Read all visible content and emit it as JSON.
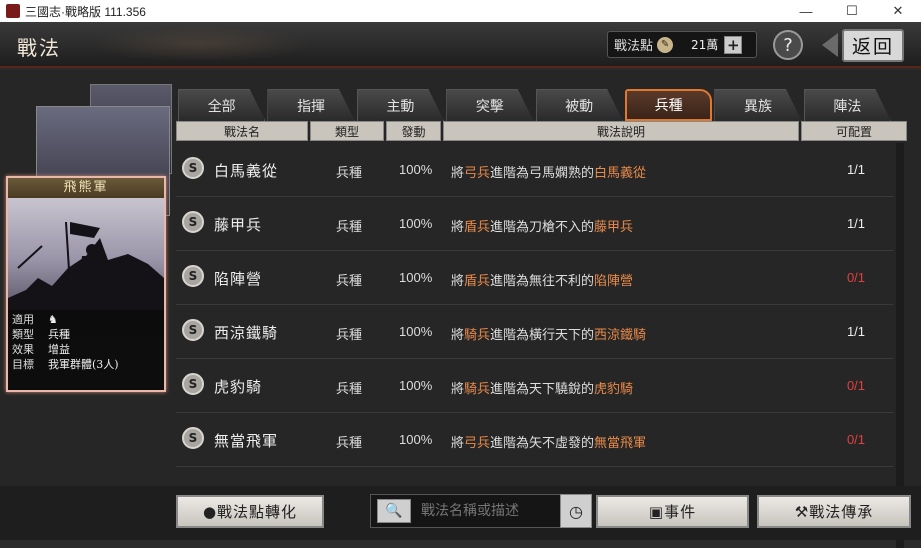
{
  "window": {
    "title": "三國志·戰略版 111.356",
    "minimize": "—",
    "maximize": "☐",
    "close": "✕"
  },
  "header": {
    "title": "戰法",
    "points_label": "戰法點",
    "points_value": "21",
    "points_unit": "萬",
    "plus": "+",
    "help": "?",
    "back": "返回"
  },
  "card": {
    "name": "飛熊軍",
    "rows": [
      {
        "key": "適用",
        "value": ""
      },
      {
        "key": "類型",
        "value": "兵種"
      },
      {
        "key": "效果",
        "value": "增益"
      },
      {
        "key": "目標",
        "value": "我軍群體(3人)"
      }
    ]
  },
  "tabs": [
    "全部",
    "指揮",
    "主動",
    "突擊",
    "被動",
    "兵種",
    "異族",
    "陣法"
  ],
  "active_tab": "兵種",
  "columns": [
    "戰法名",
    "類型",
    "發動",
    "戰法說明",
    "可配置"
  ],
  "skills": [
    {
      "grade": "S",
      "name": "白馬義從",
      "type": "兵種",
      "rate": "100%",
      "d1": "將",
      "d2": "弓兵",
      "d3": "進階為弓馬嫻熟的",
      "d4": "白馬義從",
      "slot": "1/1",
      "available": true
    },
    {
      "grade": "S",
      "name": "藤甲兵",
      "type": "兵種",
      "rate": "100%",
      "d1": "將",
      "d2": "盾兵",
      "d3": "進階為刀槍不入的",
      "d4": "藤甲兵",
      "slot": "1/1",
      "available": true
    },
    {
      "grade": "S",
      "name": "陷陣營",
      "type": "兵種",
      "rate": "100%",
      "d1": "將",
      "d2": "盾兵",
      "d3": "進階為無往不利的",
      "d4": "陷陣營",
      "slot": "0/1",
      "available": false
    },
    {
      "grade": "S",
      "name": "西涼鐵騎",
      "type": "兵種",
      "rate": "100%",
      "d1": "將",
      "d2": "騎兵",
      "d3": "進階為橫行天下的",
      "d4": "西涼鐵騎",
      "slot": "1/1",
      "available": true
    },
    {
      "grade": "S",
      "name": "虎豹騎",
      "type": "兵種",
      "rate": "100%",
      "d1": "將",
      "d2": "騎兵",
      "d3": "進階為天下驍銳的",
      "d4": "虎豹騎",
      "slot": "0/1",
      "available": false
    },
    {
      "grade": "S",
      "name": "無當飛軍",
      "type": "兵種",
      "rate": "100%",
      "d1": "將",
      "d2": "弓兵",
      "d3": "進階為矢不虛發的",
      "d4": "無當飛軍",
      "slot": "0/1",
      "available": false
    }
  ],
  "footer": {
    "convert": "戰法點轉化",
    "search_placeholder": "戰法名稱或描述",
    "events": "事件",
    "inherit": "戰法傳承"
  },
  "colors": {
    "accent": "#e07830",
    "highlight": "#e88a4a",
    "unavailable": "#e04040"
  }
}
